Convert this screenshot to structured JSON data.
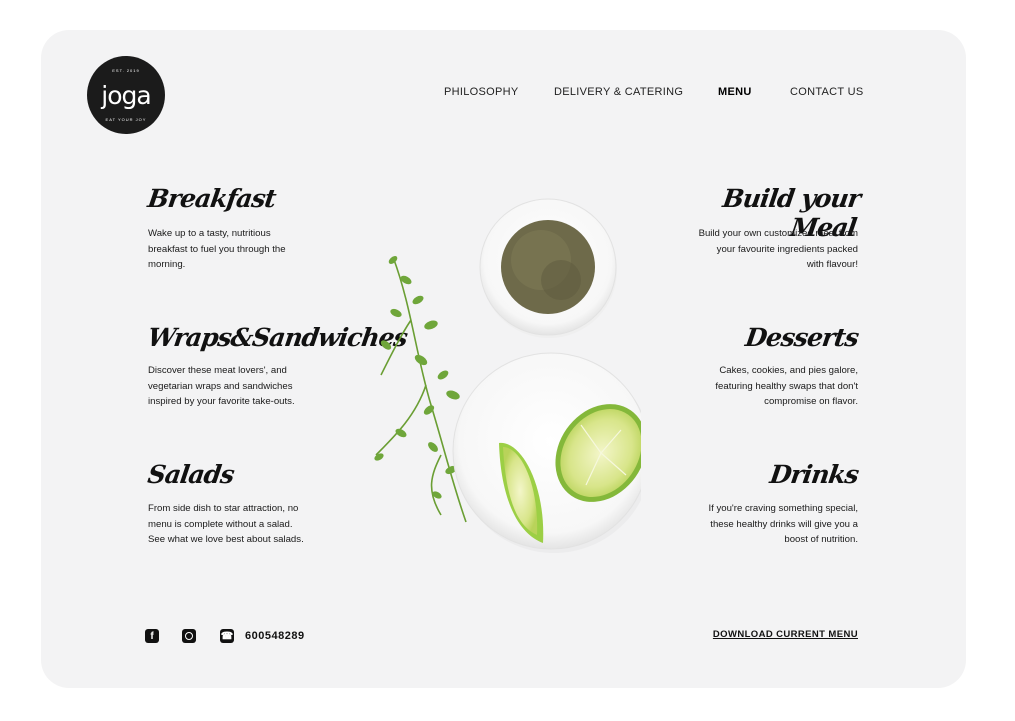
{
  "logo": {
    "word": "joga",
    "top_text": "EST. 2019",
    "bottom_text": "EAT YOUR JOY"
  },
  "nav": [
    "PHILOSOPHY",
    "DELIVERY & CATERING",
    "MENU",
    "CONTACT US"
  ],
  "nav_active": "MENU",
  "menu_left": [
    {
      "title": "Breakfast",
      "desc": [
        "Wake up to a tasty, nutritious",
        "breakfast to fuel you through the",
        "morning."
      ]
    },
    {
      "title": "Wraps&Sandwiches",
      "desc": [
        "Discover these meat lovers', and",
        "vegetarian wraps and sandwiches",
        "inspired by your favorite take-outs."
      ]
    },
    {
      "title": "Salads",
      "desc": [
        "From side dish to star attraction, no",
        "menu is complete without a salad.",
        "See what we love best about salads."
      ]
    }
  ],
  "menu_right": [
    {
      "title": "Build your Meal",
      "desc": [
        "Build your own customized meal from",
        "your favourite ingredients packed",
        "with flavour!"
      ]
    },
    {
      "title": "Desserts",
      "desc": [
        "Cakes, cookies, and pies galore,",
        "featuring healthy swaps that don't",
        "compromise on flavor."
      ]
    },
    {
      "title": "Drinks",
      "desc": [
        "If you're craving something special,",
        "these healthy drinks will give you a",
        "boost of nutrition."
      ]
    }
  ],
  "footer": {
    "phone": "600548289",
    "download": "DOWNLOAD CURRENT MENU"
  },
  "colors": {
    "background": "#f3f3f4",
    "text": "#111111",
    "logo_bg": "#1b1b1b",
    "lime": "#9ccf45",
    "herb": "#5f9c2e"
  }
}
